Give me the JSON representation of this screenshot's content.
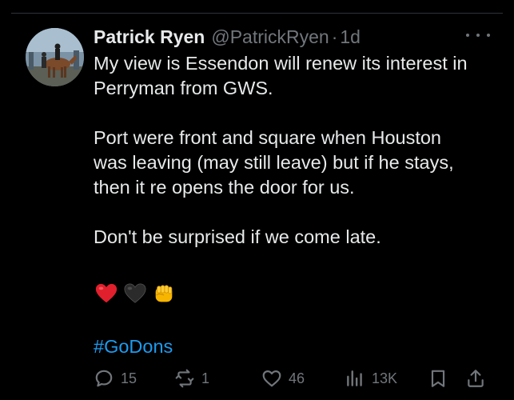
{
  "tweet": {
    "display_name": "Patrick Ryen",
    "handle": "@PatrickRyen",
    "separator": "·",
    "time": "1d",
    "lines": [
      "My view is Essendon will renew its interest in",
      "Perryman from GWS.",
      "Port were front and square when Houston",
      "was leaving (may still leave) but if he stays,",
      "then it re opens the door for us.",
      "Don't be surprised if we come late."
    ],
    "emojis": [
      "red-heart",
      "black-heart",
      "oncoming-fist"
    ],
    "hashtag": "#GoDons"
  },
  "actions": {
    "replies": "15",
    "reposts": "1",
    "likes": "46",
    "views": "13K"
  },
  "colors": {
    "background": "#000000",
    "text": "#e7e9ea",
    "muted": "#71767b",
    "link": "#1d9bf0",
    "divider": "#2f3336"
  }
}
